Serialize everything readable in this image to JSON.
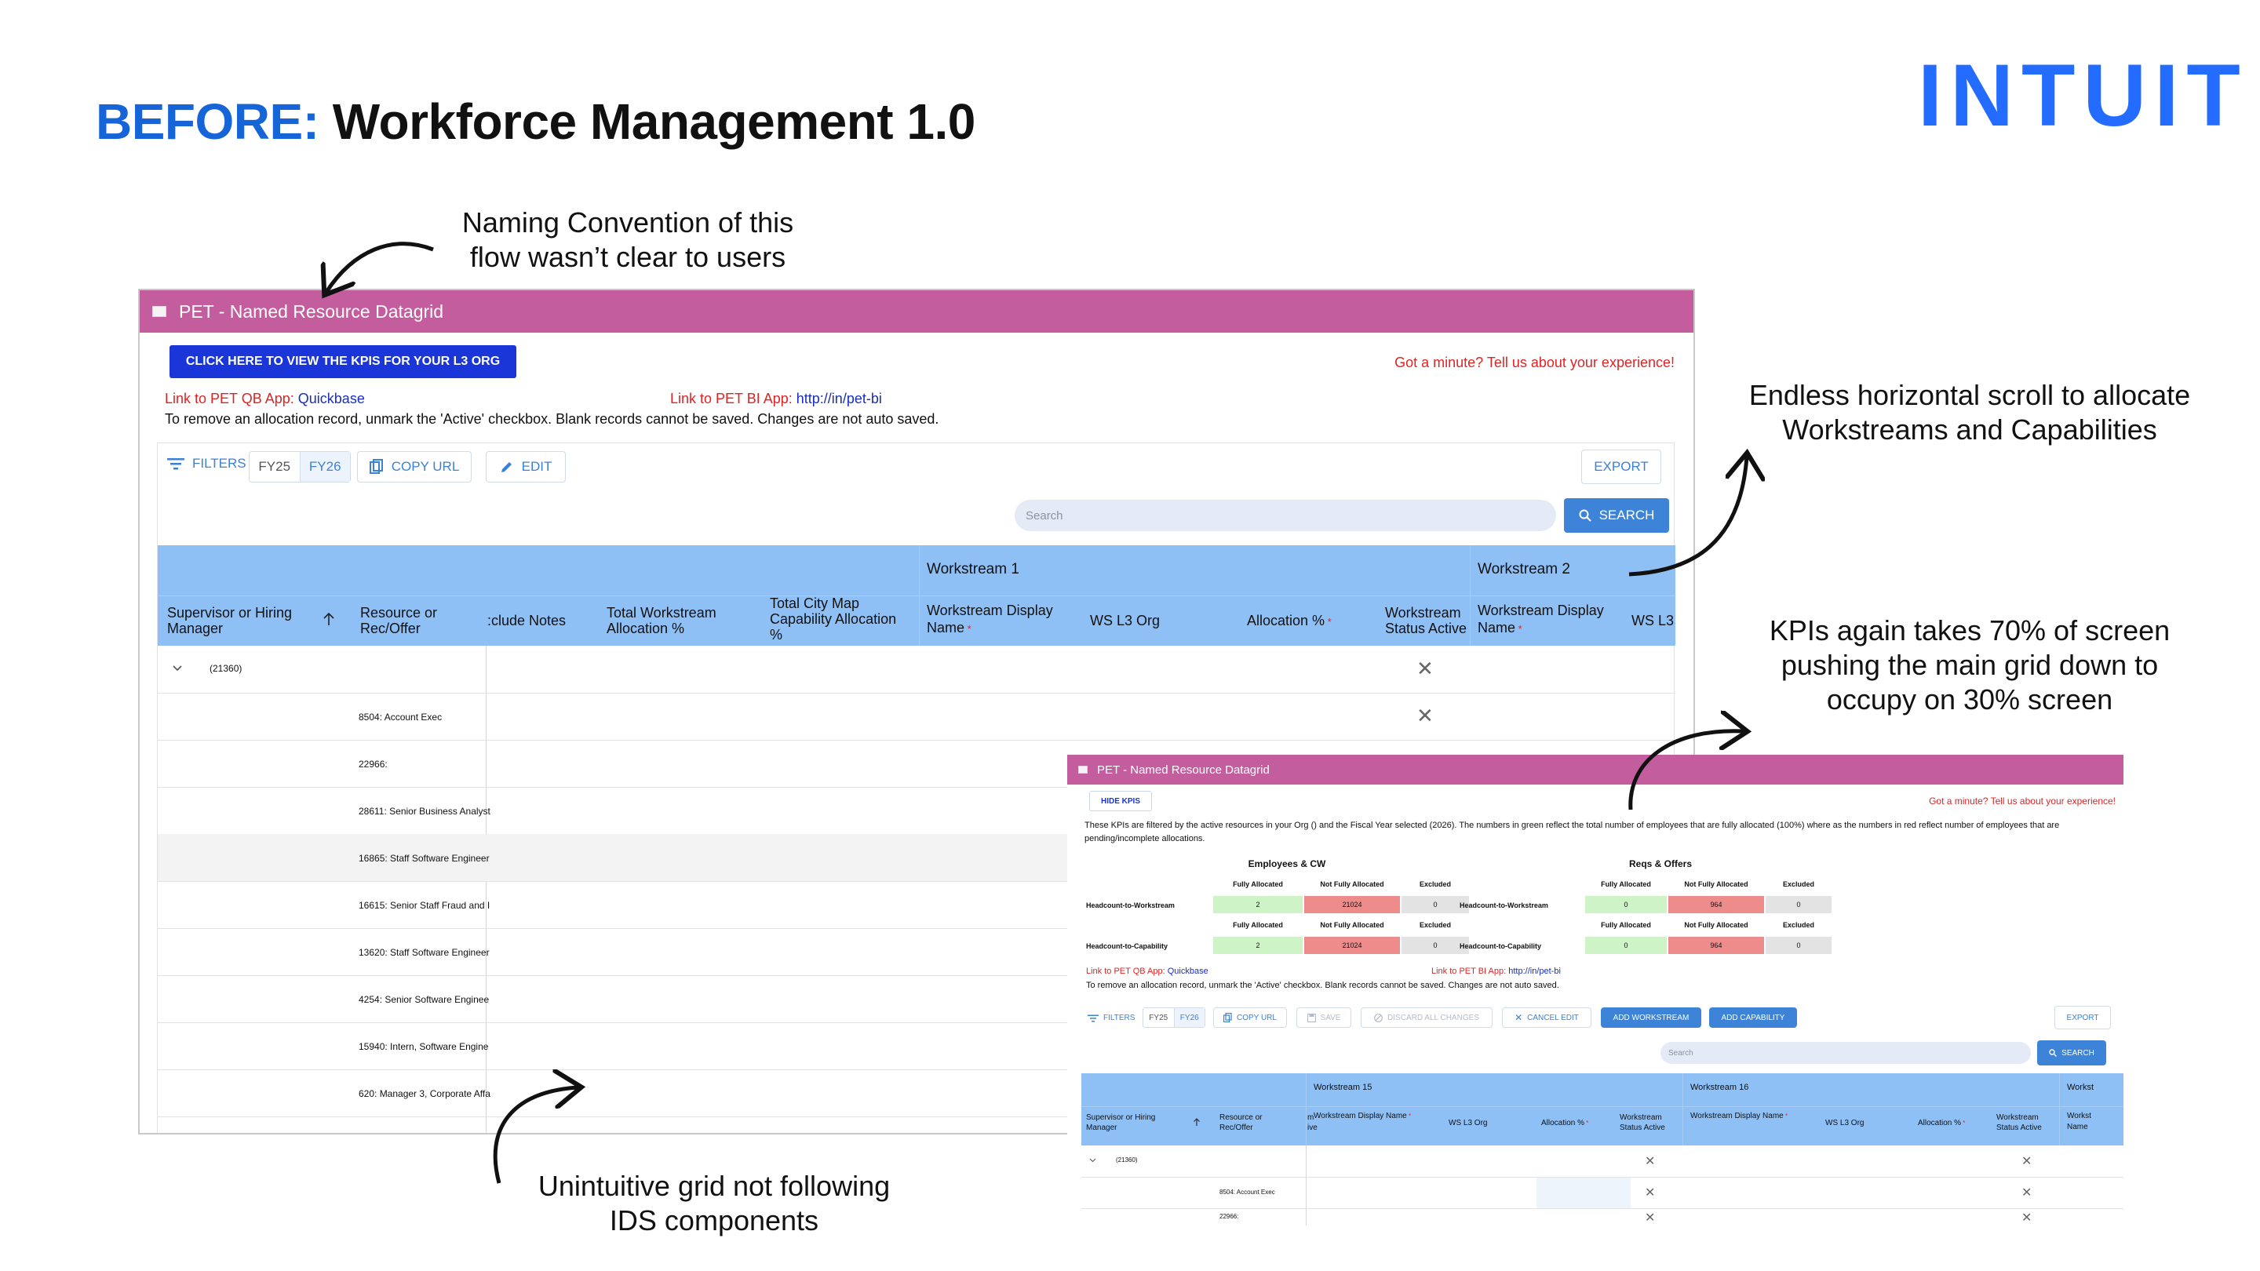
{
  "slide": {
    "title_prefix": "BEFORE:",
    "title_main": "Workforce Management 1.0",
    "logo": "INTUIT",
    "annotations": {
      "naming_line1": "Naming Convention of this",
      "naming_line2": "flow wasn’t clear to users",
      "scroll_line1": "Endless horizontal scroll to allocate",
      "scroll_line2": "Workstreams and Capabilities",
      "kpi_line1": "KPIs again takes 70% of screen",
      "kpi_line2": "pushing the main grid down to",
      "kpi_line3": "occupy on 30% screen",
      "grid_line1": "Unintuitive grid not following",
      "grid_line2": "IDS components"
    }
  },
  "window1": {
    "title": "PET - Named Resource Datagrid",
    "kpi_button": "CLICK HERE TO VIEW THE KPIS FOR YOUR L3 ORG",
    "feedback": "Got a minute? Tell us about your experience!",
    "qb_label": "Link to PET QB App:",
    "qb_link": "Quickbase",
    "bi_label": "Link to PET BI App:",
    "bi_link": "http://in/pet-bi",
    "instructions": "To remove an allocation record, unmark the 'Active' checkbox. Blank records cannot be saved. Changes are not auto saved.",
    "toolbar": {
      "filters": "FILTERS",
      "fy25": "FY25",
      "fy26": "FY26",
      "copy_url": "COPY URL",
      "edit": "EDIT",
      "export": "EXPORT"
    },
    "search": {
      "placeholder": "Search",
      "button": "SEARCH"
    },
    "groups": {
      "ws1": "Workstream 1",
      "ws2": "Workstream 2"
    },
    "columns": {
      "supervisor": "Supervisor or Hiring Manager",
      "resource": "Resource or Rec/Offer",
      "exclude_notes": ":clude Notes",
      "total_ws": "Total Workstream Allocation %",
      "total_city": "Total City Map Capability Allocation %",
      "ws_display_name": "Workstream Display Name",
      "ws_l3_org": "WS L3 Org",
      "allocation": "Allocation %",
      "ws_status": "Workstream Status Active",
      "ws2_display_name": "Workstream Display Name",
      "ws2_l3_org": "WS L3"
    },
    "group_row": "(21360)",
    "rows": [
      "8504: Account Exec",
      "22966:",
      "28611: Senior Business Analyst",
      "16865: Staff Software Engineer",
      "16615: Senior Staff Fraud and I",
      "13620: Staff Software Engineer",
      "4254: Senior Software Enginee",
      "15940: Intern, Software Engine",
      "620: Manager 3, Corporate Affa"
    ]
  },
  "window2": {
    "title": "PET - Named Resource Datagrid",
    "hide_kpis": "HIDE KPIS",
    "feedback": "Got a minute? Tell us about your experience!",
    "kpi_description": "These KPIs are filtered by the active resources in your Org () and the Fiscal Year selected (2026). The numbers in green reflect the total number of employees that are fully allocated (100%) where as the numbers in red reflect number of employees that are pending/incomplete allocations.",
    "kpi_tables": [
      {
        "title": "Employees & CW",
        "headers": [
          "Fully Allocated",
          "Not Fully Allocated",
          "Excluded"
        ],
        "rows": [
          {
            "label": "Headcount-to-Workstream",
            "values": [
              "2",
              "21024",
              "0"
            ]
          },
          {
            "label": "Headcount-to-Capability",
            "values": [
              "2",
              "21024",
              "0"
            ]
          }
        ]
      },
      {
        "title": "Reqs & Offers",
        "headers": [
          "Fully Allocated",
          "Not Fully Allocated",
          "Excluded"
        ],
        "rows": [
          {
            "label": "Headcount-to-Workstream",
            "values": [
              "0",
              "964",
              "0"
            ]
          },
          {
            "label": "Headcount-to-Capability",
            "values": [
              "0",
              "964",
              "0"
            ]
          }
        ]
      }
    ],
    "qb_label": "Link to PET QB App:",
    "qb_link": "Quickbase",
    "bi_label": "Link to PET BI App:",
    "bi_link": "http://in/pet-bi",
    "instructions": "To remove an allocation record, unmark the 'Active' checkbox. Blank records cannot be saved. Changes are not auto saved.",
    "toolbar": {
      "filters": "FILTERS",
      "fy25": "FY25",
      "fy26": "FY26",
      "copy_url": "COPY URL",
      "save": "SAVE",
      "discard": "DISCARD ALL CHANGES",
      "cancel_edit": "CANCEL EDIT",
      "add_workstream": "ADD WORKSTREAM",
      "add_capability": "ADD CAPABILITY",
      "export": "EXPORT"
    },
    "search": {
      "placeholder": "Search",
      "button": "SEARCH"
    },
    "groups": {
      "ws15": "Workstream 15",
      "ws16": "Workstream 16",
      "ws17": "Workst"
    },
    "columns": {
      "supervisor": "Supervisor or Hiring Manager",
      "resource": "Resource or Rec/Offer",
      "clipped_top": "m",
      "clipped_bottom": "ive",
      "ws_display_name": "Workstream Display Name",
      "ws_l3_org": "WS L3 Org",
      "allocation": "Allocation %",
      "ws_status": "Workstream Status Active",
      "ws16_display_name": "Workstream Display Name",
      "ws16_l3_org": "WS L3 Org",
      "ws16_allocation": "Allocation %",
      "ws16_status": "Workstream Status Active",
      "ws17_partial": "Workst Name"
    },
    "group_row": "(21360)",
    "rows": [
      "8504: Account Exec",
      "22966:"
    ]
  },
  "colors": {
    "titlebar": "#c45d9e",
    "primary_button": "#1a36d9",
    "grid_header": "#8ec0f6",
    "kpi_green": "#cdf3c7",
    "kpi_red": "#ee8c8c",
    "kpi_gray": "#e3e3e3",
    "heading_blue": "#1565d8",
    "logo_blue": "#236cff"
  },
  "icons": [
    "filter-icon",
    "copy-icon",
    "pencil-icon",
    "search-icon",
    "sort-up-icon",
    "chevron-down-icon",
    "close-icon",
    "save-icon",
    "discard-icon",
    "broken-image-icon"
  ]
}
